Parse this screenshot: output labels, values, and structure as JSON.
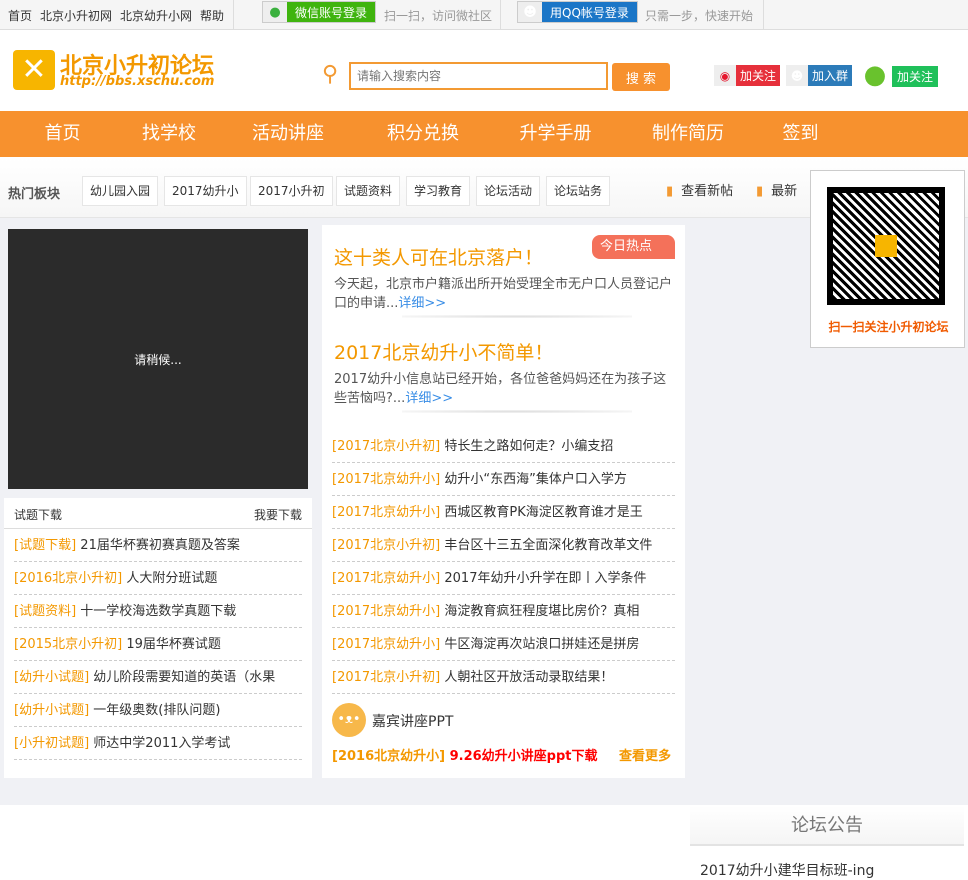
{
  "topbar": {
    "links": [
      "首页",
      "北京小升初网",
      "北京幼升小网",
      "帮助"
    ],
    "wechat_login": "微信账号登录",
    "wechat_hint": "扫一扫，访问微社区",
    "qq_login": "用QQ帐号登录",
    "qq_hint": "只需一步，快速开始"
  },
  "header": {
    "logo_title": "北京小升初论坛",
    "logo_url": "http://bbs.xschu.com",
    "search_placeholder": "请输入搜索内容",
    "search_button": "搜 索",
    "weibo_follow": "加关注",
    "qq_group": "加入群",
    "wechat_follow": "加关注"
  },
  "nav": [
    "首页",
    "找学校",
    "活动讲座",
    "积分兑换",
    "升学手册",
    "制作简历",
    "签到"
  ],
  "hot": {
    "label": "热门板块",
    "tags": [
      "幼儿园入园",
      "2017幼升小",
      "2017小升初",
      "试题资料",
      "学习教育",
      "论坛活动",
      "论坛站务"
    ],
    "new_posts": "查看新帖",
    "latest": "最新"
  },
  "video": {
    "loading": "请稍候..."
  },
  "downloads": {
    "title": "试题下载",
    "more": "我要下载",
    "items": [
      {
        "cat": "[试题下载]",
        "text": "21届华杯赛初赛真题及答案"
      },
      {
        "cat": "[2016北京小升初]",
        "text": "人大附分班试题"
      },
      {
        "cat": "[试题资料]",
        "text": "十一学校海选数学真题下载"
      },
      {
        "cat": "[2015北京小升初]",
        "text": "19届华杯赛试题"
      },
      {
        "cat": "[幼升小试题]",
        "text": "幼儿阶段需要知道的英语（水果"
      },
      {
        "cat": "[幼升小试题]",
        "text": "一年级奥数(排队问题)"
      },
      {
        "cat": "[小升初试题]",
        "text": "师达中学2011入学考试"
      }
    ]
  },
  "hotnews": {
    "badge": "今日热点",
    "items": [
      {
        "title": "这十类人可在北京落户！",
        "desc": "今天起，北京市户籍派出所开始受理全市无户口人员登记户口的申请...",
        "more": "详细>>"
      },
      {
        "title": "2017北京幼升小不简单！",
        "desc": "2017幼升小信息站已经开始，各位爸爸妈妈还在为孩子这些苦恼吗?...",
        "more": "详细>>"
      }
    ],
    "list": [
      {
        "cat": "[2017北京小升初]",
        "text": "特长生之路如何走？小编支招"
      },
      {
        "cat": "[2017北京幼升小]",
        "text": "幼升小“东西海”集体户口入学方"
      },
      {
        "cat": "[2017北京幼升小]",
        "text": "西城区教育PK海淀区教育谁才是王"
      },
      {
        "cat": "[2017北京小升初]",
        "text": "丰台区十三五全面深化教育改革文件"
      },
      {
        "cat": "[2017北京幼升小]",
        "text": "2017年幼升小升学在即丨入学条件"
      },
      {
        "cat": "[2017北京幼升小]",
        "text": "海淀教育疯狂程度堪比房价？真相"
      },
      {
        "cat": "[2017北京幼升小]",
        "text": "牛区海淀再次站浪口拼娃还是拼房"
      },
      {
        "cat": "[2017北京小升初]",
        "text": "人朝社区开放活动录取结果！"
      }
    ],
    "ppt_title": "嘉宾讲座PPT",
    "ppt_cat": "[2016北京幼升小]",
    "ppt_text": "9.26幼升小讲座ppt下载",
    "ppt_more": "查看更多"
  },
  "qr": {
    "caption": "扫一扫关注小升初论坛"
  },
  "notice": {
    "title": "论坛公告",
    "items": [
      "2017幼升小建华目标班-ing"
    ]
  }
}
